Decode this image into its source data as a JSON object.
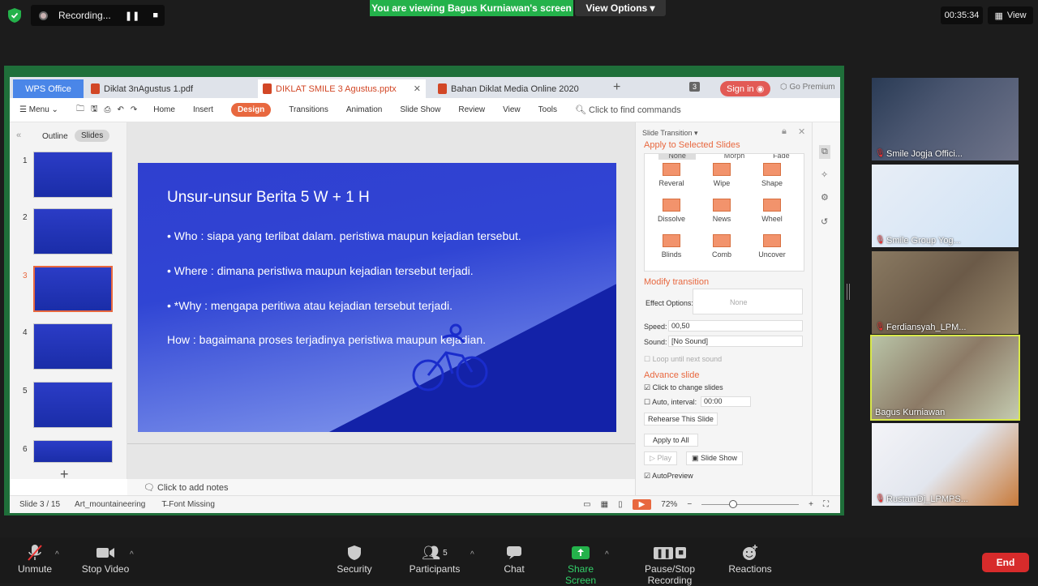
{
  "zoom_top": {
    "recording_label": "Recording...",
    "viewing_banner": "You are viewing Bagus Kurniawan's screen",
    "view_options": "View Options",
    "timer": "00:35:34",
    "view_label": "View"
  },
  "wps": {
    "tabs": [
      {
        "label": "WPS Office"
      },
      {
        "label": "Diklat  3nAgustus 1.pdf"
      },
      {
        "label": "DIKLAT SMILE 3 Agustus.pptx"
      },
      {
        "label": "Bahan Diklat Media Online 2020"
      }
    ],
    "tab_count": "3",
    "sign_in": "Sign in",
    "go_premium": "Go Premium",
    "menu_label": "Menu",
    "ribbon_tabs": [
      "Home",
      "Insert",
      "Design",
      "Transitions",
      "Animation",
      "Slide Show",
      "Review",
      "View",
      "Tools"
    ],
    "find_commands": "Click to find commands",
    "outline_tab": "Outline",
    "slides_tab": "Slides",
    "slide_numbers": [
      "1",
      "2",
      "3",
      "4",
      "5",
      "6"
    ],
    "notes_placeholder": "Click to add notes",
    "status": {
      "slide_pos": "Slide 3 / 15",
      "theme": "Art_mountaineering",
      "font_missing": "Font Missing",
      "zoom": "72%"
    }
  },
  "slide": {
    "title": "Unsur-unsur Berita 5 W + 1 H",
    "bullets": [
      "•  Who : siapa yang terlibat dalam. peristiwa maupun kejadian tersebut.",
      "•  Where :  dimana peristiwa maupun kejadian tersebut terjadi.",
      "•  *Why : mengapa peritiwa atau kejadian tersebut terjadi."
    ],
    "how_line": "How : bagaimana proses terjadinya peristiwa maupun kejadian."
  },
  "transition_panel": {
    "header": "Slide Transition",
    "apply_selected": "Apply to Selected Slides",
    "top_row": [
      "None",
      "Morph",
      "Fade"
    ],
    "effects": [
      "Reveral",
      "Wipe",
      "Shape",
      "Dissolve",
      "News",
      "Wheel",
      "Blinds",
      "Comb",
      "Uncover"
    ],
    "modify": "Modify transition",
    "effect_options_label": "Effect Options:",
    "effect_options_value": "None",
    "speed_label": "Speed:",
    "speed_value": "00,50",
    "sound_label": "Sound:",
    "sound_value": "[No Sound]",
    "loop_label": "Loop until next sound",
    "advance": "Advance slide",
    "click_change": "Click to change slides",
    "auto_interval": "Auto, interval:",
    "interval_value": "00:00",
    "rehearse": "Rehearse This Slide",
    "apply_all": "Apply to All",
    "play": "Play",
    "slide_show": "Slide Show",
    "autopreview": "AutoPreview"
  },
  "participants": [
    {
      "name": "Smile Jogja Offici..."
    },
    {
      "name": "Smile Group Yog..."
    },
    {
      "name": "Ferdiansyah_LPM..."
    },
    {
      "name": "Bagus Kurniawan"
    },
    {
      "name": "RustamDj_LPMPS..."
    }
  ],
  "toolbar": {
    "unmute": "Unmute",
    "stop_video": "Stop Video",
    "security": "Security",
    "participants": "Participants",
    "participants_count": "5",
    "chat": "Chat",
    "share_screen": "Share Screen",
    "pause_rec": "Pause/Stop Recording",
    "reactions": "Reactions",
    "end": "End"
  },
  "colors": {
    "accent": "#e8683f",
    "zoom_green": "#24b24b",
    "end_red": "#d72b2b"
  }
}
